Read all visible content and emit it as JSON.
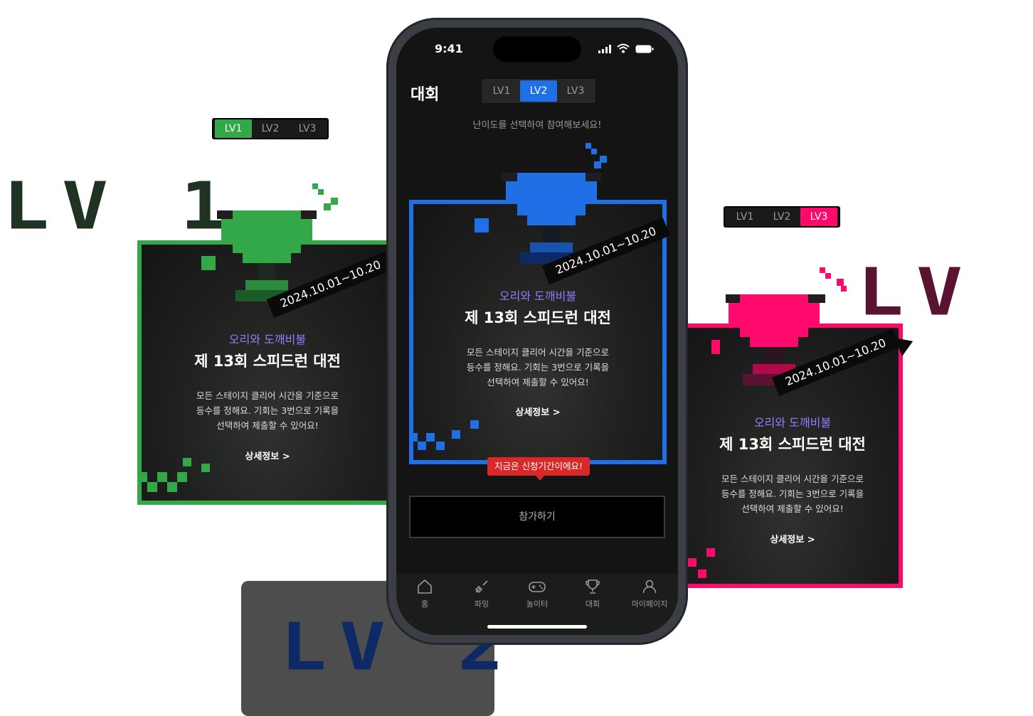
{
  "colors": {
    "lv1": "#32a848",
    "lv2": "#1f6fe6",
    "lv3": "#ff0a6c",
    "lv1_dark": "#1e3324",
    "lv2_dark": "#0d2a66",
    "lv3_dark": "#5a1431",
    "purple": "#8f7dff",
    "badge_red": "#d82828"
  },
  "level_tabs": [
    "LV1",
    "LV2",
    "LV3"
  ],
  "big_labels": {
    "lv1": "LV 1",
    "lv2": "LV 2",
    "lv3": "LV 3"
  },
  "status_bar": {
    "time": "9:41"
  },
  "app": {
    "title": "대회",
    "hint": "난이도를 선택하여 참여해보세요!",
    "join_button": "참가하기",
    "tooltip": "지금은 신청기간이에요!"
  },
  "contest": {
    "date_range": "2024.10.01~10.20",
    "subtitle": "오리와 도깨비불",
    "title": "제 13회 스피드런 대전",
    "desc_line1": "모든 스테이지 클리어 시간을 기준으로",
    "desc_line2": "등수를 정해요. 기회는 3번으로 기록을",
    "desc_line3": "선택하여 제출할 수 있어요!",
    "more": "상세정보 >"
  },
  "bottom_nav": [
    {
      "label": "홈",
      "icon": "home-icon"
    },
    {
      "label": "파밍",
      "icon": "shovel-icon"
    },
    {
      "label": "놀이터",
      "icon": "gamepad-icon"
    },
    {
      "label": "대회",
      "icon": "trophy-icon"
    },
    {
      "label": "마이페이지",
      "icon": "user-icon"
    }
  ]
}
